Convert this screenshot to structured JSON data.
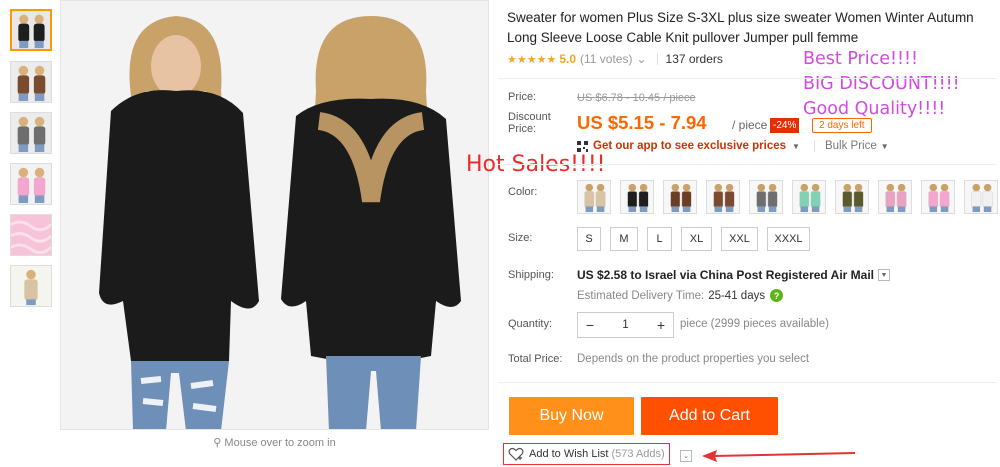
{
  "product": {
    "title": "Sweater for women Plus Size S-3XL plus size sweater Women Winter Autumn Long Sleeve Loose Cable Knit pullover Jumper pull femme",
    "stars": "★★★★★",
    "rating": "5.0",
    "votes": "(11 votes)",
    "votes_caret": "⌄",
    "orders": "137 orders"
  },
  "overlays": {
    "hot_sales": "Hot Sales!!!!",
    "promo_lines": [
      "Best Price!!!!",
      "BIG DISCOUNT!!!!",
      "Good Quality!!!!"
    ]
  },
  "pricing": {
    "price_label": "Price:",
    "original_price": "US $6.78 - 10.45 / piece",
    "discount_label_1": "Discount",
    "discount_label_2": "Price:",
    "discount_price": "US $5.15 - 7.94",
    "per_unit": "/ piece",
    "discount_pct": "-24%",
    "days_left": "2 days left",
    "app_promo": "Get our app to see exclusive prices",
    "bulk_price": "Bulk Price"
  },
  "color": {
    "label": "Color:",
    "swatch_colors": [
      "#d9c3a5",
      "#1e1e1e",
      "#6b3e26",
      "#7a4b2e",
      "#6e6e6e",
      "#7fd3b4",
      "#5b5a2a",
      "#e9a3c0",
      "#f3a7cf",
      "#f1f1f1",
      "#e8c34a"
    ]
  },
  "size": {
    "label": "Size:",
    "options": [
      "S",
      "M",
      "L",
      "XL",
      "XXL",
      "XXXL"
    ]
  },
  "shipping": {
    "label": "Shipping:",
    "text": "US $2.58 to Israel via China Post Registered Air Mail",
    "estimate_label": "Estimated Delivery Time:",
    "estimate_value": "25-41 days",
    "help": "?"
  },
  "quantity": {
    "label": "Quantity:",
    "minus": "−",
    "value": "1",
    "plus": "+",
    "available": "piece (2999 pieces available)"
  },
  "total": {
    "label": "Total Price:",
    "note": "Depends on the product properties you select"
  },
  "actions": {
    "buy_now": "Buy Now",
    "add_to_cart": "Add to Cart",
    "wishlist": "Add to Wish List",
    "wishlist_count": "(573 Adds)",
    "wishlist_caret": "⌄"
  },
  "gallery": {
    "zoom_hint": "Mouse over to zoom in",
    "thumbnail_colors": [
      "#1e1e1e",
      "#7a4b2e",
      "#6e6e6e",
      "#f3a7cf",
      "#f6c3d8",
      "#d9c3a5"
    ]
  },
  "colors": {
    "accent_orange": "#ff9019",
    "cart_orange": "#ff4f00",
    "price_orange": "#ff6600",
    "star_yellow": "#f6a623",
    "hot_sales_red": "#ee2a2a",
    "promo_magenta": "#d14be0"
  }
}
